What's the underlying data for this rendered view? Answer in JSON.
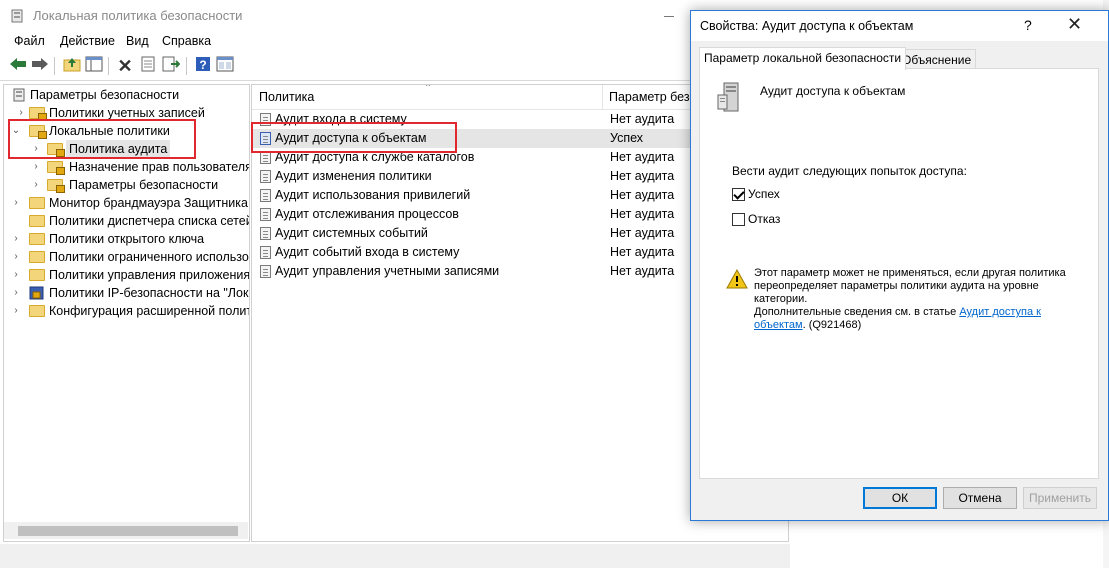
{
  "main_window": {
    "title": "Локальная политика безопасности",
    "menu": [
      "Файл",
      "Действие",
      "Вид",
      "Справка"
    ],
    "tree": [
      {
        "label": "Параметры безопасности",
        "level": 0,
        "expanded": true
      },
      {
        "label": "Политики учетных записей",
        "level": 1,
        "expanded": false
      },
      {
        "label": "Локальные политики",
        "level": 1,
        "expanded": true
      },
      {
        "label": "Политика аудита",
        "level": 2,
        "expanded": false,
        "selected": true
      },
      {
        "label": "Назначение прав пользователя",
        "level": 2,
        "expanded": false
      },
      {
        "label": "Параметры безопасности",
        "level": 2,
        "expanded": false
      },
      {
        "label": "Монитор брандмауэра Защитника W",
        "level": 1,
        "expanded": false
      },
      {
        "label": "Политики диспетчера списка сетей",
        "level": 1,
        "expanded": false
      },
      {
        "label": "Политики открытого ключа",
        "level": 1,
        "expanded": false
      },
      {
        "label": "Политики ограниченного использо",
        "level": 1,
        "expanded": false
      },
      {
        "label": "Политики управления приложения",
        "level": 1,
        "expanded": false
      },
      {
        "label": "Политики IP-безопасности на \"Лока",
        "level": 1,
        "expanded": false
      },
      {
        "label": "Конфигурация расширенной полит",
        "level": 1,
        "expanded": false
      }
    ],
    "list": {
      "col_policy": "Политика",
      "col_setting": "Параметр безо",
      "rows": [
        {
          "name": "Аудит входа в систему",
          "value": "Нет аудита"
        },
        {
          "name": "Аудит доступа к объектам",
          "value": "Успех",
          "selected": true
        },
        {
          "name": "Аудит доступа к службе каталогов",
          "value": "Нет аудита"
        },
        {
          "name": "Аудит изменения политики",
          "value": "Нет аудита"
        },
        {
          "name": "Аудит использования привилегий",
          "value": "Нет аудита"
        },
        {
          "name": "Аудит отслеживания процессов",
          "value": "Нет аудита"
        },
        {
          "name": "Аудит системных событий",
          "value": "Нет аудита"
        },
        {
          "name": "Аудит событий входа в систему",
          "value": "Нет аудита"
        },
        {
          "name": "Аудит управления учетными записями",
          "value": "Нет аудита"
        }
      ]
    },
    "toolbar_icons": [
      "back-arrow-icon",
      "forward-arrow-icon",
      "up-folder-icon",
      "show-tree-icon",
      "delete-icon",
      "properties-icon",
      "export-list-icon",
      "help-icon",
      "console-icon"
    ]
  },
  "dialog": {
    "title": "Свойства: Аудит доступа к объектам",
    "help_glyph": "?",
    "close_glyph": "✕",
    "tabs": [
      "Параметр локальной безопасности",
      "Объяснение"
    ],
    "policy_name": "Аудит доступа к объектам",
    "audit_prompt": "Вести аудит следующих попыток доступа:",
    "success_label": "Успех",
    "success_checked": true,
    "failure_label": "Отказ",
    "failure_checked": false,
    "warning_text": "Этот параметр может не применяться, если другая политика переопределяет параметры политики аудита на уровне категории.",
    "more_info_prefix": "Дополнительные сведения см. в статье ",
    "more_info_link": "Аудит доступа к объектам",
    "more_info_suffix": ". (Q921468)",
    "buttons": {
      "ok": "ОК",
      "cancel": "Отмена",
      "apply": "Применить"
    }
  },
  "colors": {
    "highlight": "#e0282e",
    "dialog_border": "#2b79d6",
    "link": "#0066cc"
  }
}
